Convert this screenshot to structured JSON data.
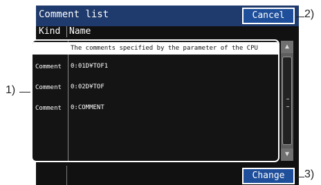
{
  "window": {
    "title": "Comment list"
  },
  "buttons": {
    "cancel": "Cancel",
    "change": "Change"
  },
  "columns": {
    "kind": "Kind",
    "name": "Name"
  },
  "rows": [
    {
      "kind": "",
      "name": "The comments specified by the parameter of the CPU",
      "selected": true
    },
    {
      "kind": "Comment",
      "name": "0:01D¥TOF1",
      "selected": false
    },
    {
      "kind": "Comment",
      "name": "0:02D¥TOF",
      "selected": false
    },
    {
      "kind": "Comment",
      "name": "0:COMMENT",
      "selected": false
    }
  ],
  "callouts": {
    "c1": "1)",
    "c2": "2)",
    "c3": "3)"
  },
  "icons": {
    "scroll_up": "triangle-up-icon",
    "scroll_down": "triangle-down-icon"
  }
}
